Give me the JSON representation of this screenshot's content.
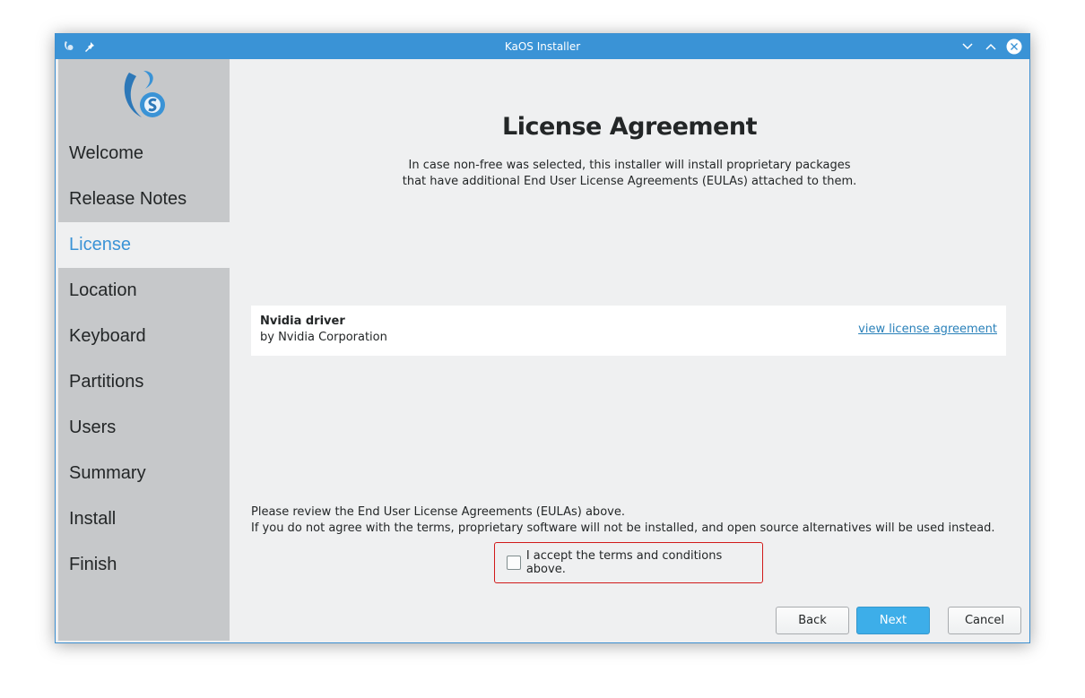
{
  "window": {
    "title": "KaOS Installer"
  },
  "sidebar": {
    "items": [
      {
        "label": "Welcome"
      },
      {
        "label": "Release Notes"
      },
      {
        "label": "License",
        "active": true
      },
      {
        "label": "Location"
      },
      {
        "label": "Keyboard"
      },
      {
        "label": "Partitions"
      },
      {
        "label": "Users"
      },
      {
        "label": "Summary"
      },
      {
        "label": "Install"
      },
      {
        "label": "Finish"
      }
    ]
  },
  "main": {
    "title": "License Agreement",
    "intro_line1": "In case non-free was selected, this installer will install proprietary packages",
    "intro_line2": "that have additional End User License Agreements (EULAs) attached to them.",
    "package": {
      "name": "Nvidia driver",
      "vendor": "by Nvidia Corporation",
      "link": "view license agreement"
    },
    "review_line1": "Please review the End User License Agreements (EULAs) above.",
    "review_line2": "If you do not agree with the terms, proprietary software will not be installed, and open source alternatives will be used instead.",
    "accept_label": "I accept the terms and conditions above.",
    "accept_checked": false
  },
  "buttons": {
    "back": "Back",
    "next": "Next",
    "cancel": "Cancel"
  },
  "colors": {
    "accent": "#3a93d6",
    "sidebar": "#c6c8ca",
    "error": "#d11a1a",
    "primary": "#3daee9"
  }
}
